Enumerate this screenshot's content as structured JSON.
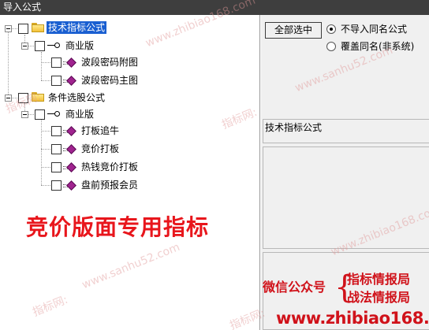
{
  "window": {
    "title": "导入公式"
  },
  "tree": {
    "root1": {
      "label": "技术指标公式",
      "child": {
        "label": "商业版",
        "items": [
          "波段密码附图",
          "波段密码主图"
        ]
      }
    },
    "root2": {
      "label": "条件选股公式",
      "child": {
        "label": "商业版",
        "items": [
          "打板追牛",
          "竞价打板",
          "热钱竞价打板",
          "盘前预报会员"
        ]
      }
    }
  },
  "banner": "竞价版面专用指标",
  "options": {
    "select_all": "全部选中",
    "radio_no_import": "不导入同名公式",
    "radio_overwrite": "覆盖同名(非系统)"
  },
  "category_label": "技术指标公式",
  "promo": {
    "wechat": "微信公众号",
    "line1": "指标情报局",
    "line2": "战法情报局",
    "url": "www.zhibiao168.com"
  },
  "watermark": {
    "site_a": "www.zhibiao168.com",
    "site_b": "www.sanhu52.com",
    "prefix": "指标网:"
  },
  "colors": {
    "title_bar": "#3e3e3e",
    "selection": "#1a5fd1",
    "promo_red": "#d0121a"
  }
}
